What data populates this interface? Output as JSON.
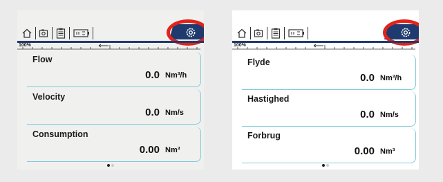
{
  "colors": {
    "accent_blue": "#1e3a6e",
    "highlight_red": "#e0231b",
    "frame_cyan": "#7ccbd9"
  },
  "toolbar": {
    "icons": [
      "home-icon",
      "camera-icon",
      "clipboard-icon",
      "battery-icon"
    ],
    "settings_icon": "gear-icon"
  },
  "scale": {
    "label": "100%"
  },
  "screens": [
    {
      "language": "English",
      "measurements": [
        {
          "label": "Flow",
          "value": "0.0",
          "unit": "Nm³/h"
        },
        {
          "label": "Velocity",
          "value": "0.0",
          "unit": "Nm/s"
        },
        {
          "label": "Consumption",
          "value": "0.00",
          "unit": "Nm³"
        }
      ],
      "pager": {
        "current": 1,
        "total": 2
      }
    },
    {
      "language": "Danish",
      "measurements": [
        {
          "label": "Flyde",
          "value": "0.0",
          "unit": "Nm³/h"
        },
        {
          "label": "Hastighed",
          "value": "0.0",
          "unit": "Nm/s"
        },
        {
          "label": "Forbrug",
          "value": "0.00",
          "unit": "Nm³"
        }
      ],
      "pager": {
        "current": 1,
        "total": 2
      }
    }
  ]
}
